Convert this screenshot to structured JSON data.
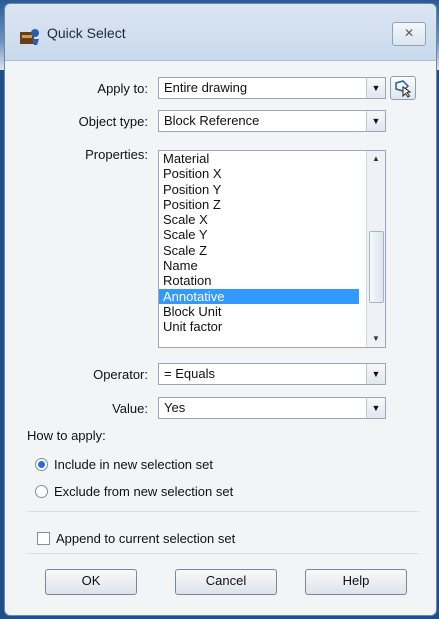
{
  "window": {
    "title": "Quick Select",
    "close_label": "✕"
  },
  "apply_to": {
    "label": "Apply to:",
    "value": "Entire drawing"
  },
  "object_type": {
    "label": "Object type:",
    "value": "Block Reference"
  },
  "properties": {
    "label": "Properties:",
    "items": [
      "Material",
      "Position X",
      "Position Y",
      "Position Z",
      "Scale X",
      "Scale Y",
      "Scale Z",
      "Name",
      "Rotation",
      "Annotative",
      "Block Unit",
      "Unit factor"
    ],
    "selected": "Annotative"
  },
  "operator": {
    "label": "Operator:",
    "value": "= Equals"
  },
  "value": {
    "label": "Value:",
    "value": "Yes"
  },
  "how_to_apply": {
    "label": "How to apply:",
    "include_label": "Include in new selection set",
    "exclude_label": "Exclude from new selection set",
    "selected": "include"
  },
  "append": {
    "label": "Append to current selection set",
    "checked": false
  },
  "buttons": {
    "ok": "OK",
    "cancel": "Cancel",
    "help": "Help"
  },
  "colors": {
    "selection": "#3399ff",
    "title_bar": "#c9d9ec"
  }
}
